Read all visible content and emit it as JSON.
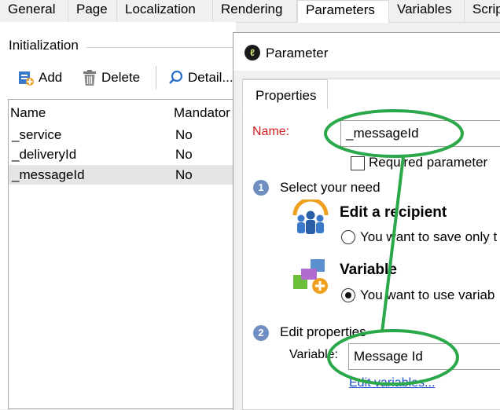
{
  "tabs": [
    "General",
    "Page",
    "Localization",
    "Rendering",
    "Parameters",
    "Variables",
    "Scrip"
  ],
  "active_tab": "Parameters",
  "initialization": {
    "group_title": "Initialization",
    "toolbar": {
      "add": "Add",
      "delete": "Delete",
      "detail": "Detail..."
    },
    "columns": [
      "Name",
      "Mandator"
    ],
    "rows": [
      {
        "name": "_service",
        "mandatory": "No"
      },
      {
        "name": "_deliveryId",
        "mandatory": "No"
      },
      {
        "name": "_messageId",
        "mandatory": "No"
      }
    ]
  },
  "dialog": {
    "title": "Parameter",
    "tab": "Properties",
    "name_label": "Name:",
    "name_value": "_messageId",
    "required_label": "Required parameter",
    "step1": {
      "number": "1",
      "label": "Select your need"
    },
    "option1": {
      "title": "Edit a recipient",
      "radio_label": "You want to save only t",
      "selected": false
    },
    "option2": {
      "title": "Variable",
      "radio_label": "You want to use variab",
      "selected": true
    },
    "step2": {
      "number": "2",
      "label": "Edit properties"
    },
    "variable_label": "Variable:",
    "variable_value": "Message Id",
    "edit_variables_link": "Edit variables..."
  },
  "colors": {
    "name_label": "#d62020",
    "annotation": "#2aa84a",
    "link": "#1b50c8",
    "step_badge": "#6f8fc0"
  }
}
